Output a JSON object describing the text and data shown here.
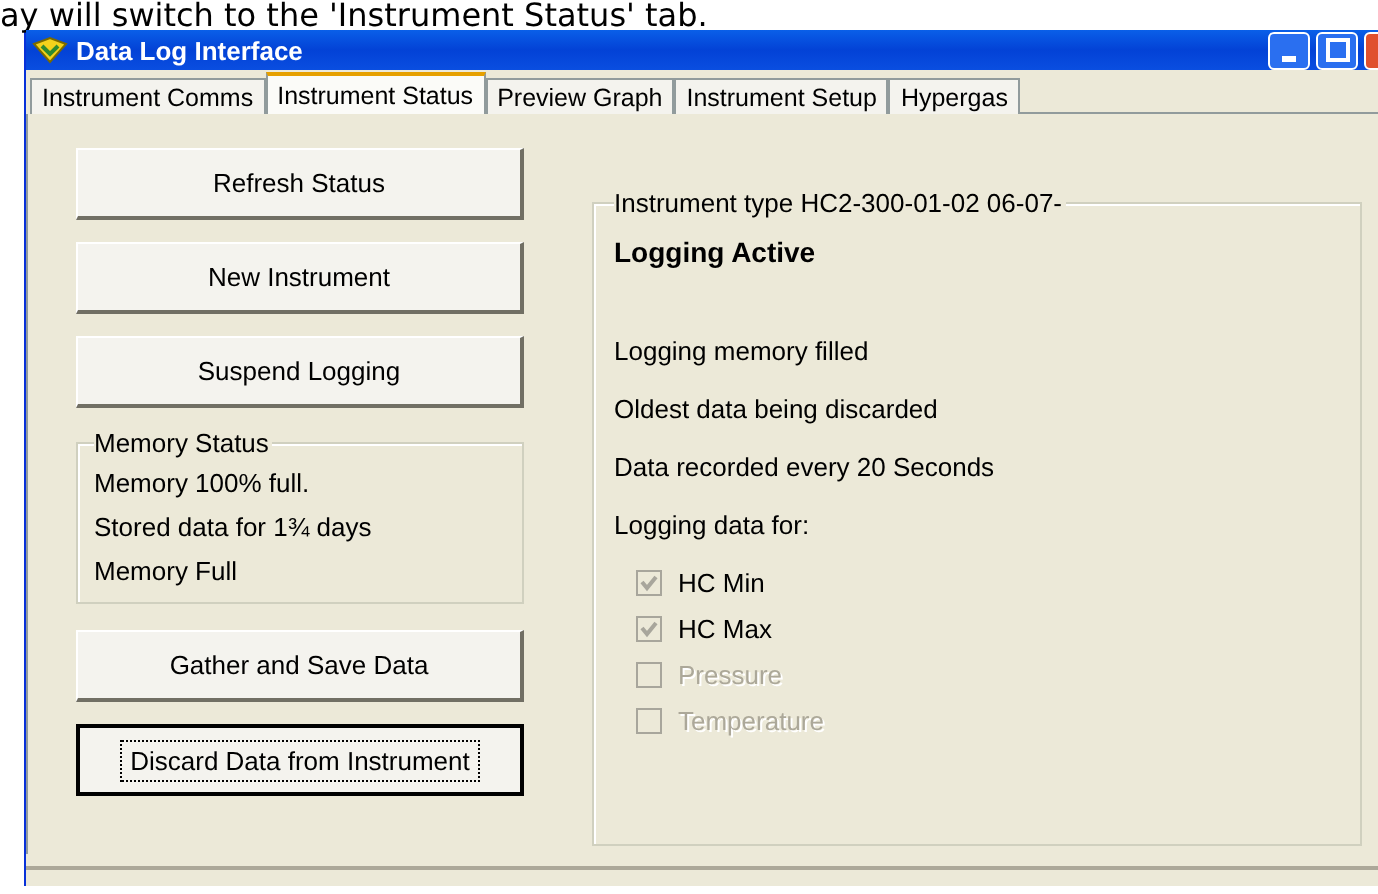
{
  "caption": "ay will switch to the 'Instrument Status' tab.",
  "window": {
    "title": "Data Log Interface"
  },
  "tabs": [
    {
      "label": "Instrument Comms",
      "selected": false
    },
    {
      "label": "Instrument Status",
      "selected": true
    },
    {
      "label": "Preview Graph",
      "selected": false
    },
    {
      "label": "Instrument Setup",
      "selected": false
    },
    {
      "label": "Hypergas",
      "selected": false
    }
  ],
  "buttons_top": [
    {
      "label": "Refresh Status",
      "focused": false
    },
    {
      "label": "New Instrument",
      "focused": false
    },
    {
      "label": "Suspend Logging",
      "focused": false
    }
  ],
  "memory_status": {
    "title": "Memory Status",
    "lines": [
      "Memory 100% full.",
      "Stored data for 1¾ days",
      "Memory Full"
    ]
  },
  "buttons_bottom": [
    {
      "label": "Gather and Save Data",
      "focused": false
    },
    {
      "label": "Discard Data from Instrument",
      "focused": true
    }
  ],
  "instrument": {
    "title": "Instrument type HC2-300-01-02 06-07-",
    "state": "Logging Active",
    "messages": [
      "Logging memory filled",
      "Oldest data being discarded",
      "Data recorded every 20 Seconds"
    ],
    "logging_label": "Logging data for:",
    "channels": [
      {
        "label": "HC Min",
        "checked": true,
        "disabled": false
      },
      {
        "label": "HC Max",
        "checked": true,
        "disabled": false
      },
      {
        "label": "Pressure",
        "checked": false,
        "disabled": true
      },
      {
        "label": "Temperature",
        "checked": false,
        "disabled": true
      }
    ]
  }
}
